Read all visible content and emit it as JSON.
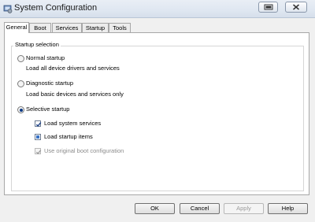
{
  "window": {
    "title": "System Configuration",
    "icons": {
      "app": "system-config-icon",
      "minimize": "minimize-icon",
      "close": "close-icon"
    }
  },
  "tabs": [
    {
      "label": "General",
      "selected": true
    },
    {
      "label": "Boot",
      "selected": false
    },
    {
      "label": "Services",
      "selected": false
    },
    {
      "label": "Startup",
      "selected": false
    },
    {
      "label": "Tools",
      "selected": false
    }
  ],
  "startup_selection": {
    "legend": "Startup selection",
    "normal": {
      "label": "Normal startup",
      "description": "Load all device drivers and services",
      "selected": false
    },
    "diagnostic": {
      "label": "Diagnostic startup",
      "description": "Load basic devices and services only",
      "selected": false
    },
    "selective": {
      "label": "Selective startup",
      "selected": true,
      "options": [
        {
          "label": "Load system services",
          "state": "checked",
          "enabled": true
        },
        {
          "label": "Load startup items",
          "state": "indeterminate",
          "enabled": true
        },
        {
          "label": "Use original boot configuration",
          "state": "checked",
          "enabled": false
        }
      ]
    }
  },
  "buttons": {
    "ok": "OK",
    "cancel": "Cancel",
    "apply": "Apply",
    "help": "Help"
  },
  "colors": {
    "accent": "#0d3a84",
    "titlebar": "#dfe7f1",
    "disabled_text": "#8c8c8c"
  }
}
